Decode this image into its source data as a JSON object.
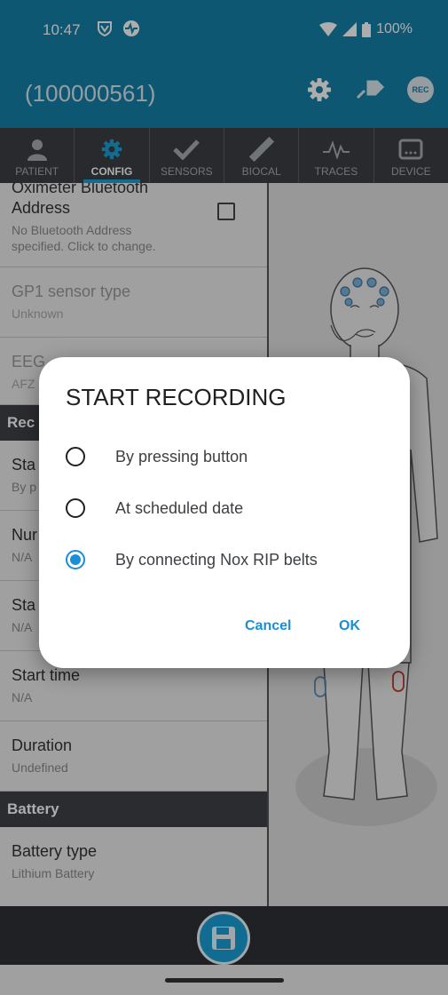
{
  "status_bar": {
    "time": "10:47",
    "battery": "100%"
  },
  "app_bar": {
    "title": "(100000561)",
    "rec_label": "REC"
  },
  "tabs": [
    {
      "label": "PATIENT",
      "icon": "person-icon",
      "active": false
    },
    {
      "label": "CONFIG",
      "icon": "gear-icon",
      "active": true
    },
    {
      "label": "SENSORS",
      "icon": "checkmark-icon",
      "active": false
    },
    {
      "label": "BIOCAL",
      "icon": "ruler-icon",
      "active": false
    },
    {
      "label": "TRACES",
      "icon": "waveform-icon",
      "active": false
    },
    {
      "label": "DEVICE",
      "icon": "device-icon",
      "active": false
    }
  ],
  "settings": {
    "oximeter": {
      "title_top": "Oximeter Bluetooth",
      "title": "Address",
      "subtitle_1": "No Bluetooth Address",
      "subtitle_2": "specified. Click to change."
    },
    "gp1": {
      "title": "GP1 sensor type",
      "subtitle": "Unknown"
    },
    "eeg": {
      "title": "EEG",
      "subtitle": "AFZ"
    },
    "recording_section": "Rec",
    "start": {
      "title": "Sta",
      "subtitle": "By p"
    },
    "number": {
      "title": "Nur",
      "subtitle": "N/A"
    },
    "start_date": {
      "title": "Sta",
      "subtitle": "N/A"
    },
    "start_time": {
      "title": "Start time",
      "subtitle": "N/A"
    },
    "duration": {
      "title": "Duration",
      "subtitle": "Undefined"
    },
    "battery_section": "Battery",
    "battery_type": {
      "title": "Battery type",
      "subtitle": "Lithium Battery"
    }
  },
  "dialog": {
    "title": "START RECORDING",
    "options": [
      {
        "label": "By pressing button",
        "checked": false
      },
      {
        "label": "At scheduled date",
        "checked": false
      },
      {
        "label": "By connecting Nox RIP belts",
        "checked": true
      }
    ],
    "cancel_label": "Cancel",
    "ok_label": "OK"
  },
  "colors": {
    "primary": "#1580a9",
    "accent": "#1a8fd8",
    "tab_bg": "#3b3f45"
  }
}
